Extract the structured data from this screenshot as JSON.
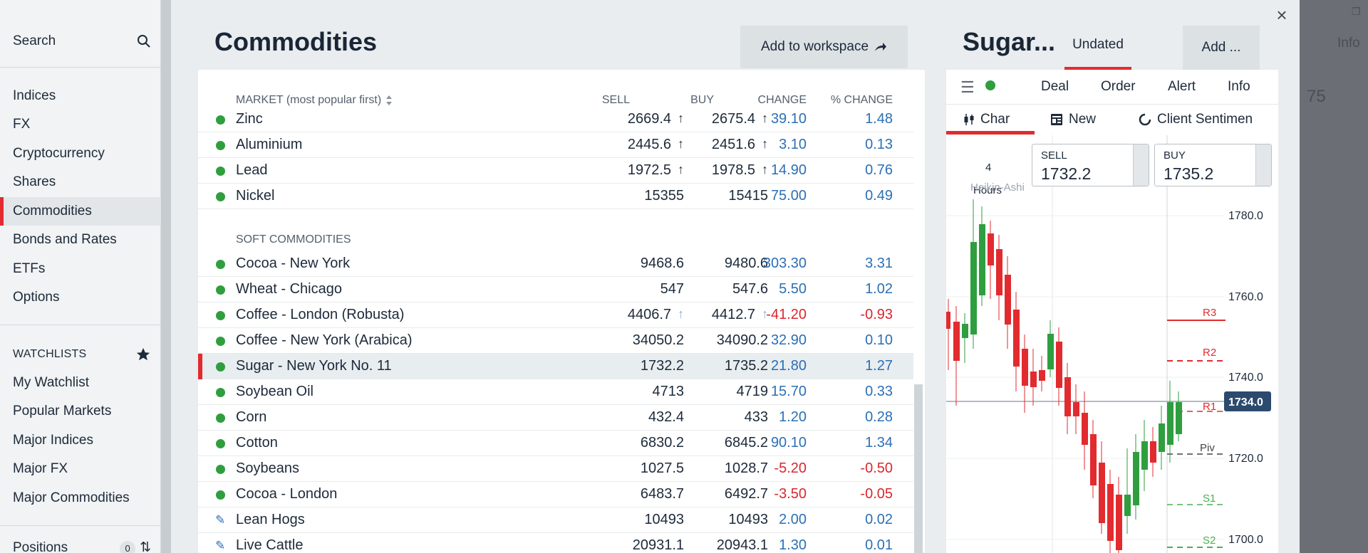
{
  "sidebar": {
    "search_label": "Search",
    "items": [
      {
        "label": "Indices"
      },
      {
        "label": "FX"
      },
      {
        "label": "Cryptocurrency"
      },
      {
        "label": "Shares"
      },
      {
        "label": "Commodities"
      },
      {
        "label": "Bonds and Rates"
      },
      {
        "label": "ETFs"
      },
      {
        "label": "Options"
      }
    ],
    "watchlists_heading": "WATCHLISTS",
    "watchlists": [
      {
        "label": "My Watchlist"
      },
      {
        "label": "Popular Markets"
      },
      {
        "label": "Major Indices"
      },
      {
        "label": "Major FX"
      },
      {
        "label": "Major Commodities"
      }
    ],
    "positions_label": "Positions",
    "positions_count": "0"
  },
  "main": {
    "title": "Commodities",
    "add_to_workspace": "Add to workspace",
    "columns": {
      "market": "MARKET (most popular first)",
      "sell": "SELL",
      "buy": "BUY",
      "change": "CHANGE",
      "pct_change": "% CHANGE"
    },
    "metals": [
      {
        "name": "Zinc",
        "sell": "2669.4",
        "buy": "2675.4",
        "change": "39.10",
        "pct": "1.48",
        "arrow": "↑"
      },
      {
        "name": "Aluminium",
        "sell": "2445.6",
        "buy": "2451.6",
        "change": "3.10",
        "pct": "0.13",
        "arrow": "↑"
      },
      {
        "name": "Lead",
        "sell": "1972.5",
        "buy": "1978.5",
        "change": "14.90",
        "pct": "0.76",
        "arrow": "↑"
      },
      {
        "name": "Nickel",
        "sell": "15355",
        "buy": "15415",
        "change": "75.00",
        "pct": "0.49"
      }
    ],
    "soft_label": "SOFT COMMODITIES",
    "soft": [
      {
        "name": "Cocoa - New York",
        "sell": "9468.6",
        "buy": "9480.6",
        "change": "303.30",
        "pct": "3.31"
      },
      {
        "name": "Wheat - Chicago",
        "sell": "547",
        "buy": "547.6",
        "change": "5.50",
        "pct": "1.02"
      },
      {
        "name": "Coffee - London (Robusta)",
        "sell": "4406.7",
        "buy": "4412.7",
        "change": "-41.20",
        "pct": "-0.93",
        "arrow": "↑"
      },
      {
        "name": "Coffee - New York (Arabica)",
        "sell": "34050.2",
        "buy": "34090.2",
        "change": "32.90",
        "pct": "0.10"
      },
      {
        "name": "Sugar - New York No. 11",
        "sell": "1732.2",
        "buy": "1735.2",
        "change": "21.80",
        "pct": "1.27"
      },
      {
        "name": "Soybean Oil",
        "sell": "4713",
        "buy": "4719",
        "change": "15.70",
        "pct": "0.33"
      },
      {
        "name": "Corn",
        "sell": "432.4",
        "buy": "433",
        "change": "1.20",
        "pct": "0.28"
      },
      {
        "name": "Cotton",
        "sell": "6830.2",
        "buy": "6845.2",
        "change": "90.10",
        "pct": "1.34"
      },
      {
        "name": "Soybeans",
        "sell": "1027.5",
        "buy": "1028.7",
        "change": "-5.20",
        "pct": "-0.50"
      },
      {
        "name": "Cocoa - London",
        "sell": "6483.7",
        "buy": "6492.7",
        "change": "-3.50",
        "pct": "-0.05"
      },
      {
        "name": "Lean Hogs",
        "sell": "10493",
        "buy": "10493",
        "change": "2.00",
        "pct": "0.02"
      },
      {
        "name": "Live Cattle",
        "sell": "20931.1",
        "buy": "20943.1",
        "change": "1.30",
        "pct": "0.01"
      }
    ]
  },
  "instrument": {
    "title": "Sugar...",
    "tab": "Undated",
    "add": "Add ...",
    "ticket_tabs": [
      "Deal",
      "Order",
      "Alert",
      "Info"
    ],
    "chart_tabs": [
      "Char",
      "New",
      "Client Sentimen"
    ],
    "sell_label": "SELL",
    "sell_value": "1732.2",
    "buy_label": "BUY",
    "buy_value": "1735.2",
    "interval": "4",
    "interval_unit": "Hours",
    "chart_style": "Heikin-Ashi",
    "price_ticks": [
      "1780.0",
      "1760.0",
      "1740.0",
      "1720.0",
      "1700.0"
    ],
    "current_price": "1734.0",
    "levels": [
      "R3",
      "R2",
      "R1",
      "Piv",
      "S1",
      "S2"
    ]
  },
  "background": {
    "info_tab": "Info",
    "price_fragment": "75"
  },
  "colors": {
    "accent_red": "#e22b2f",
    "positive_blue": "#2c6fb5",
    "negative_red": "#d7282e",
    "online_green": "#2f9e3f"
  }
}
